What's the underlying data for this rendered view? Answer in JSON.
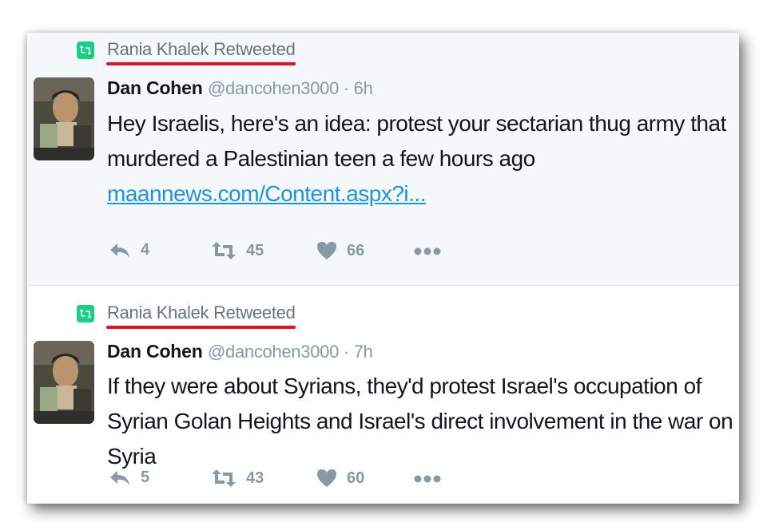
{
  "tweets": [
    {
      "retweeted_by": "Rania Khalek Retweeted",
      "name": "Dan Cohen",
      "handle": "@dancohen3000",
      "time": " · 6h",
      "text": "Hey Israelis, here's an idea: protest your sectarian thug army that murdered a Palestinian teen a few hours ago",
      "link": "maannews.com/Content.aspx?i...",
      "replies": "4",
      "retweets": "45",
      "likes": "66"
    },
    {
      "retweeted_by": "Rania Khalek Retweeted",
      "name": "Dan Cohen",
      "handle": "@dancohen3000",
      "time": " · 7h",
      "text": "If they were about Syrians, they'd protest Israel's occupation of Syrian Golan Heights and Israel's direct involvement in the war on Syria",
      "replies": "5",
      "retweets": "43",
      "likes": "60"
    }
  ],
  "colors": {
    "retweet_green": "#19cf86",
    "underline_red": "#e0141e",
    "link_blue": "#1b95e0",
    "muted_gray": "#8899a6"
  },
  "icons": [
    "retweet-icon",
    "reply-icon",
    "heart-icon",
    "more-icon",
    "avatar"
  ]
}
